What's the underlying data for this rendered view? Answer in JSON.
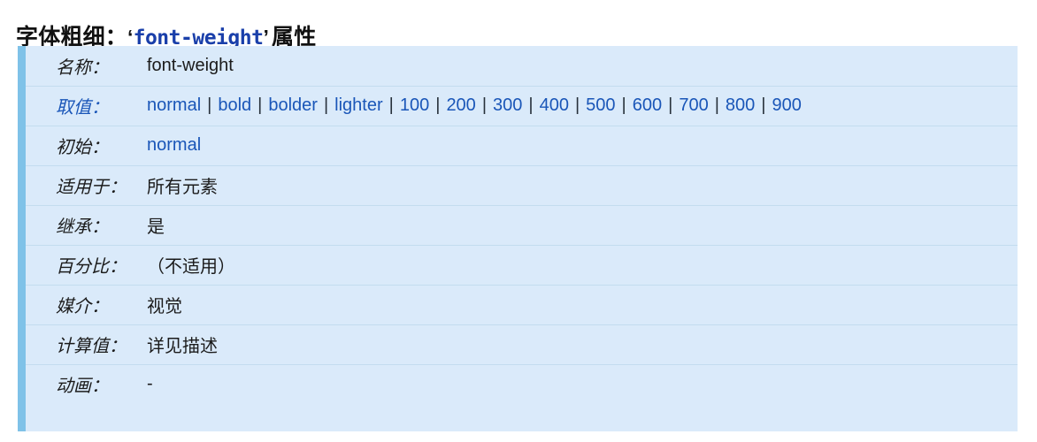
{
  "heading": {
    "prefix": "字体粗细：",
    "open_quote": "‘",
    "property_name": "font-weight",
    "close_quote": "’",
    "suffix": "属性"
  },
  "colors": {
    "panel_background": "#daeafa",
    "panel_accent_bar": "#7fc2e8",
    "row_separator": "#c3dcef",
    "link_blue": "#1a56b8",
    "heading_mono_blue": "#1a3faa",
    "text_dark": "#1b1b1b",
    "page_background": "#ffffff"
  },
  "definition_table": {
    "rows": [
      {
        "label": "名称：",
        "label_style": "dark",
        "value": "font-weight",
        "value_style": "dark"
      },
      {
        "label": "取值：",
        "label_style": "blue",
        "value": "normal | bold | bolder | lighter | 100 | 200 | 300 | 400 | 500 | 600 | 700 | 800 | 900",
        "value_style": "blue-list"
      },
      {
        "label": "初始：",
        "label_style": "dark",
        "value": "normal",
        "value_style": "blue"
      },
      {
        "label": "适用于：",
        "label_style": "dark",
        "value": "所有元素",
        "value_style": "dark"
      },
      {
        "label": "继承：",
        "label_style": "dark",
        "value": "是",
        "value_style": "dark"
      },
      {
        "label": "百分比：",
        "label_style": "dark",
        "value": "（不适用）",
        "value_style": "dark"
      },
      {
        "label": "媒介：",
        "label_style": "dark",
        "value": "视觉",
        "value_style": "dark"
      },
      {
        "label": "计算值：",
        "label_style": "dark",
        "value": "详见描述",
        "value_style": "dark"
      },
      {
        "label": "动画：",
        "label_style": "dark",
        "value": "-",
        "value_style": "dark"
      }
    ],
    "value_list_tokens": [
      "normal",
      "bold",
      "bolder",
      "lighter",
      "100",
      "200",
      "300",
      "400",
      "500",
      "600",
      "700",
      "800",
      "900"
    ],
    "value_list_separator": "|"
  }
}
